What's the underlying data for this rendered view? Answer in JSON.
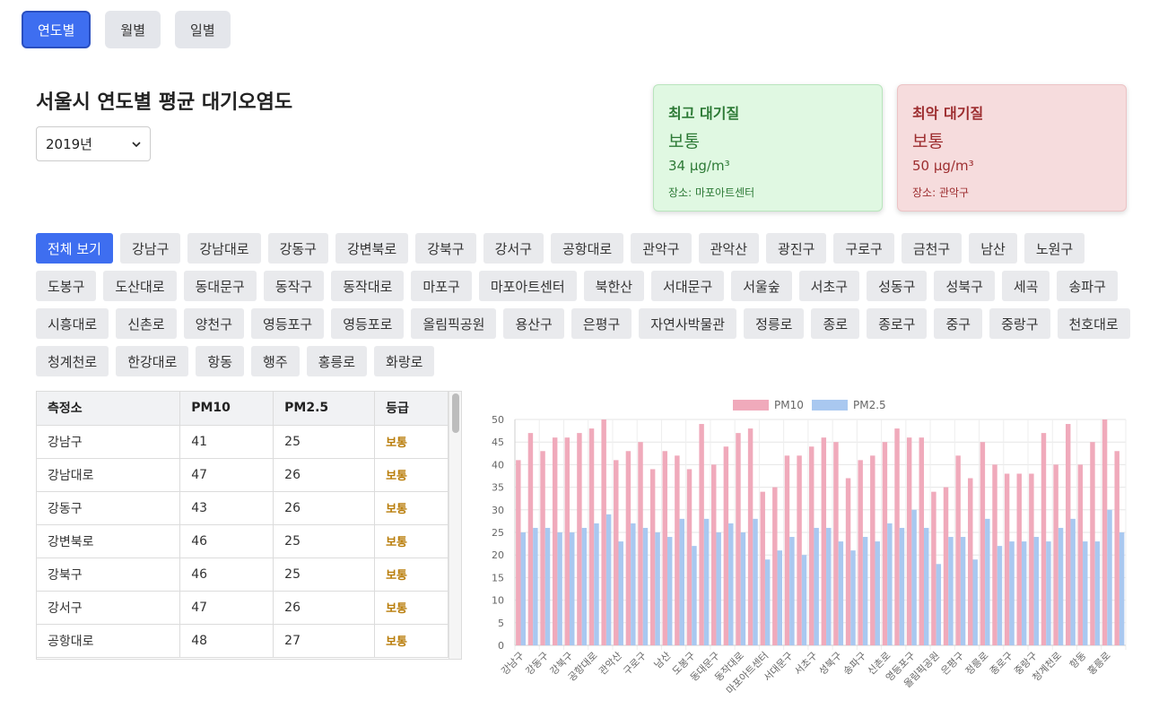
{
  "tabs": [
    "연도별",
    "월별",
    "일별"
  ],
  "title": "서울시 연도별 평균 대기오염도",
  "year_select": "2019년",
  "best_card": {
    "title": "최고 대기질",
    "grade": "보통",
    "value": "34 μg/m³",
    "location": "장소: 마포아트센터"
  },
  "worst_card": {
    "title": "최악 대기질",
    "grade": "보통",
    "value": "50 μg/m³",
    "location": "장소: 관악구"
  },
  "stations": [
    "전체 보기",
    "강남구",
    "강남대로",
    "강동구",
    "강변북로",
    "강북구",
    "강서구",
    "공항대로",
    "관악구",
    "관악산",
    "광진구",
    "구로구",
    "금천구",
    "남산",
    "노원구",
    "도봉구",
    "도산대로",
    "동대문구",
    "동작구",
    "동작대로",
    "마포구",
    "마포아트센터",
    "북한산",
    "서대문구",
    "서울숲",
    "서초구",
    "성동구",
    "성북구",
    "세곡",
    "송파구",
    "시흥대로",
    "신촌로",
    "양천구",
    "영등포구",
    "영등포로",
    "올림픽공원",
    "용산구",
    "은평구",
    "자연사박물관",
    "정릉로",
    "종로",
    "종로구",
    "중구",
    "중랑구",
    "천호대로",
    "청계천로",
    "한강대로",
    "항동",
    "행주",
    "홍릉로",
    "화랑로"
  ],
  "table": {
    "headers": [
      "측정소",
      "PM10",
      "PM2.5",
      "등급"
    ],
    "rows": [
      [
        "강남구",
        "41",
        "25",
        "보통"
      ],
      [
        "강남대로",
        "47",
        "26",
        "보통"
      ],
      [
        "강동구",
        "43",
        "26",
        "보통"
      ],
      [
        "강변북로",
        "46",
        "25",
        "보통"
      ],
      [
        "강북구",
        "46",
        "25",
        "보통"
      ],
      [
        "강서구",
        "47",
        "26",
        "보통"
      ],
      [
        "공항대로",
        "48",
        "27",
        "보통"
      ]
    ]
  },
  "colors": {
    "accent": "#3e6ef0",
    "pm10": "#f0aabb",
    "pm25": "#a9c8f0"
  },
  "chart_data": {
    "type": "bar",
    "categories": [
      "강남구",
      "강남대로",
      "강동구",
      "강변북로",
      "강북구",
      "강서구",
      "공항대로",
      "관악구",
      "관악산",
      "광진구",
      "구로구",
      "금천구",
      "남산",
      "노원구",
      "도봉구",
      "도산대로",
      "동대문구",
      "동작구",
      "동작대로",
      "마포구",
      "마포아트센터",
      "북한산",
      "서대문구",
      "서울숲",
      "서초구",
      "성동구",
      "성북구",
      "세곡",
      "송파구",
      "시흥대로",
      "신촌로",
      "양천구",
      "영등포구",
      "영등포로",
      "올림픽공원",
      "용산구",
      "은평구",
      "자연사박물관",
      "정릉로",
      "종로",
      "종로구",
      "중구",
      "중랑구",
      "천호대로",
      "청계천로",
      "한강대로",
      "항동",
      "행주",
      "홍릉로",
      "화랑로"
    ],
    "x_tick_labels": [
      "강남구",
      "강동구",
      "강북구",
      "공항대로",
      "관악산",
      "구로구",
      "남산",
      "도봉구",
      "동대문구",
      "동작대로",
      "마포아트센터",
      "서대문구",
      "서초구",
      "성북구",
      "송파구",
      "신촌로",
      "영등포구",
      "올림픽공원",
      "은평구",
      "정릉로",
      "종로구",
      "중랑구",
      "청계천로",
      "항동",
      "홍릉로"
    ],
    "series": [
      {
        "name": "PM10",
        "values": [
          41,
          47,
          43,
          46,
          46,
          47,
          48,
          50,
          41,
          43,
          45,
          39,
          43,
          42,
          39,
          49,
          40,
          44,
          47,
          48,
          34,
          35,
          42,
          42,
          44,
          46,
          45,
          37,
          41,
          42,
          45,
          48,
          46,
          46,
          34,
          35,
          42,
          37,
          45,
          40,
          38,
          38,
          38,
          47,
          40,
          49,
          40,
          45,
          50,
          43
        ]
      },
      {
        "name": "PM2.5",
        "values": [
          25,
          26,
          26,
          25,
          25,
          26,
          27,
          29,
          23,
          27,
          26,
          25,
          24,
          28,
          22,
          28,
          25,
          27,
          25,
          28,
          19,
          21,
          24,
          20,
          26,
          26,
          23,
          21,
          24,
          23,
          27,
          26,
          30,
          26,
          18,
          24,
          24,
          19,
          28,
          22,
          23,
          23,
          24,
          23,
          26,
          28,
          23,
          23,
          30,
          25
        ]
      }
    ],
    "ylim": [
      0,
      50
    ],
    "yticks": [
      0,
      5,
      10,
      15,
      20,
      25,
      30,
      35,
      40,
      45,
      50
    ],
    "legend": "top-center",
    "grid": true
  }
}
